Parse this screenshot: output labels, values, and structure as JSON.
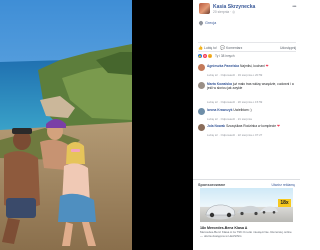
{
  "post": {
    "author": "Kasia Skrzynecka",
    "date": "20 sierpnia",
    "more_icon": "more-horizontal-icon",
    "location": "Grecja",
    "actions": {
      "like": "Lubię to!",
      "comment": "Komentarz",
      "share": "Udostępnij"
    },
    "reactions_text": "Ty i 38 innych"
  },
  "comments": [
    {
      "name": "Agnieszka Pawelska",
      "text": "Najmilsi, kochani",
      "meta": "Lubię to! · Odpowiedz · 19 sierpnia o 20:59",
      "emoji": "❤"
    },
    {
      "name": "Marta Kowalska",
      "text": "już mało tras widzę wszędzie, cudowni i a jeśli w słońcu jak zwykle",
      "meta": "Lubię to! · Odpowiedz · 20 sierpnia o 15:59"
    },
    {
      "name": "Iwona Krawczyk",
      "text": "Uwielbiam :)",
      "meta": "Lubię to! · Odpowiedz · 21 sierpnia"
    },
    {
      "name": "Jola Nowak",
      "text": "Szczęśliwa Rodzinka w komplecie",
      "meta": "Lubię to! · Odpowiedz · 22 sierpnia o 07:27",
      "emoji": "❤"
    }
  ],
  "sidebar": {
    "sponsored_label": "Sponsorowane",
    "create_ad_label": "Utwórz reklamę"
  },
  "ad": {
    "badge": "18x",
    "title": "18x Mercedes-Benz Klasa A",
    "description": "Mercedes-Benz Klasa A za 799 zł netto miesięcznie. Rezerwuj online — oferta dostępna w LEASING"
  },
  "colors": {
    "link": "#385898",
    "muted": "#90949c",
    "like": "#1877f2",
    "love": "#f33e58",
    "ad_badge": "#f7c81e"
  }
}
